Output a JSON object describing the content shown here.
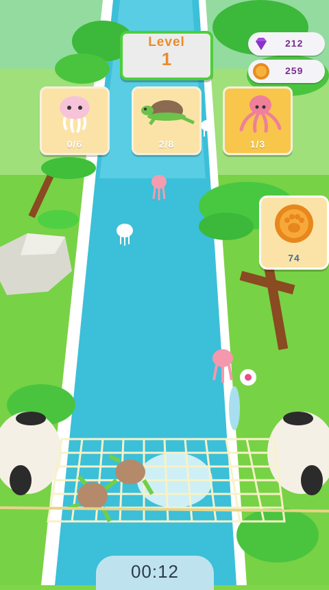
{
  "level": {
    "label": "Level",
    "number": "1"
  },
  "currency": {
    "gems": {
      "icon": "gem-icon",
      "value": "212"
    },
    "coins": {
      "icon": "coin-icon",
      "value": "259"
    }
  },
  "targets": [
    {
      "creature": "jellyfish",
      "icon": "jellyfish-icon",
      "count": "0/6"
    },
    {
      "creature": "turtle",
      "icon": "turtle-icon",
      "count": "2/8"
    },
    {
      "creature": "octopus",
      "icon": "octopus-icon",
      "count": "1/3"
    }
  ],
  "paw_bonus": {
    "icon": "paw-coin-icon",
    "value": "74"
  },
  "timer": {
    "value": "00:12"
  },
  "colors": {
    "accent_green": "#4ccf3a",
    "level_orange": "#e98b2e",
    "card_bg": "#fbe3a8",
    "river": "#3cbfd8",
    "grass": "#7fd64a"
  }
}
